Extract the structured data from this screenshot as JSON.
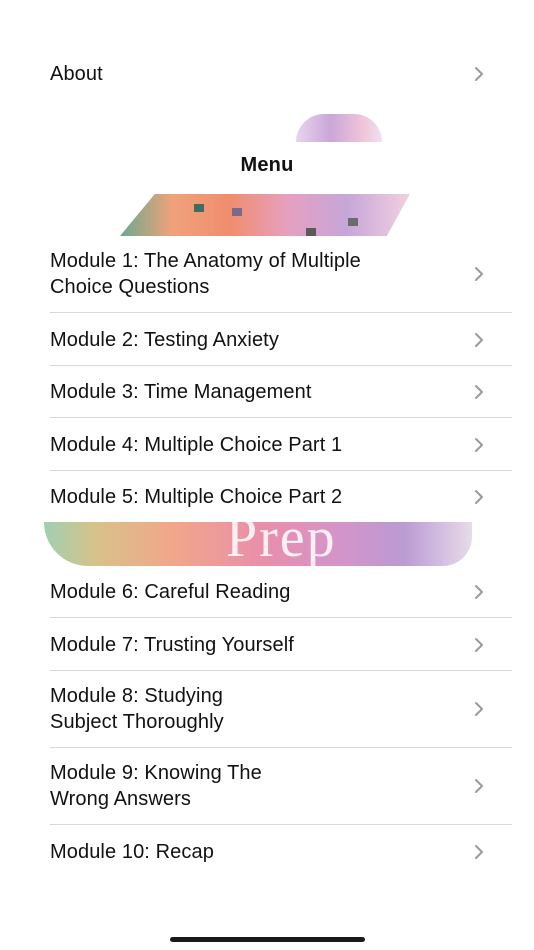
{
  "about": {
    "label": "About"
  },
  "menu": {
    "title": "Menu"
  },
  "modules": [
    {
      "label": "Module 1: The Anatomy of Multiple\nChoice Questions"
    },
    {
      "label": "Module 2: Testing Anxiety"
    },
    {
      "label": "Module 3: Time Management"
    },
    {
      "label": "Module 4: Multiple Choice Part 1"
    },
    {
      "label": "Module 5: Multiple Choice Part 2"
    },
    {
      "label": "Module 6: Careful Reading"
    },
    {
      "label": "Module 7: Trusting Yourself"
    },
    {
      "label": "Module 8: Studying\nSubject Thoroughly"
    },
    {
      "label": "Module 9: Knowing The\nWrong Answers"
    },
    {
      "label": "Module 10: Recap"
    }
  ],
  "colors": {
    "text": "#111111",
    "chevron": "#9a9a9a",
    "divider": "#d9d9d9",
    "background": "#ffffff"
  },
  "icons": {
    "row_chevron": "chevron-right-icon"
  }
}
